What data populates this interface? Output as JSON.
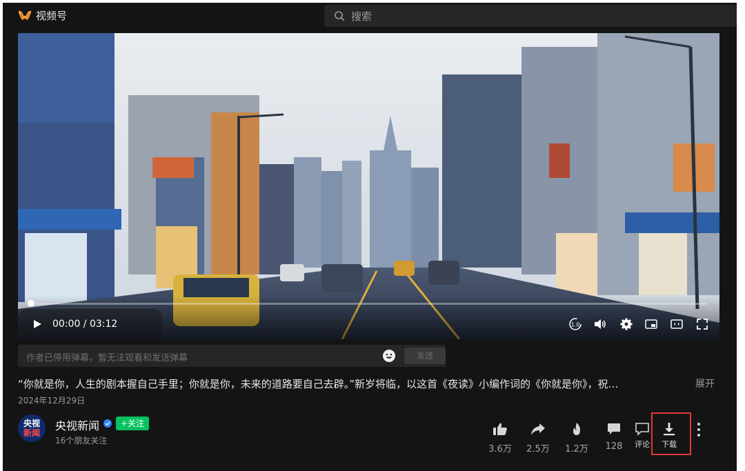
{
  "app": {
    "name": "视频号"
  },
  "search": {
    "placeholder": "搜索"
  },
  "player": {
    "current_time": "00:00",
    "duration": "03:12",
    "time_display": "00:00 / 03:12",
    "progress": 0,
    "speed_label": "1.0"
  },
  "danmaku": {
    "placeholder": "作者已停用弹幕，暂无法观看和发送弹幕",
    "send_label": "发送"
  },
  "post": {
    "description": "“你就是你，人生的剧本握自己手里；你就是你，未来的道路要自己去辟。”新岁将临，以这首《夜读》小编作词的《你就是你》，祝…",
    "expand_label": "展开",
    "date": "2024年12月29日"
  },
  "author": {
    "avatar_line1": "央视",
    "avatar_line2": "新闻",
    "name": "央视新闻",
    "follow_label": "+关注",
    "friends_text": "16个朋友关注"
  },
  "actions": {
    "like_count": "3.6万",
    "share_count": "2.5万",
    "hot_count": "1.2万",
    "comment_count": "128",
    "comment_label": "评论",
    "download_label": "下载"
  },
  "colors": {
    "accent_green": "#07c160",
    "highlight_red": "#e53935",
    "logo_orange": "#fa9d3b",
    "background": "#141414"
  }
}
